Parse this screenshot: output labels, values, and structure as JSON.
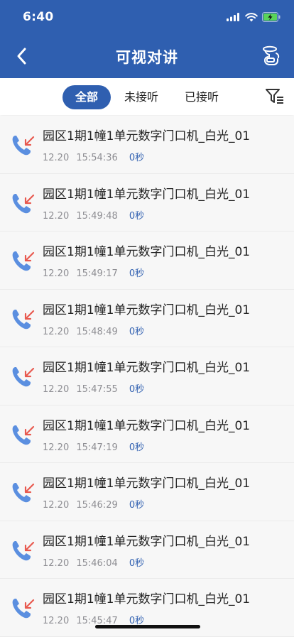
{
  "status_bar": {
    "time": "6:40"
  },
  "navbar": {
    "title": "可视对讲",
    "back_icon": "chevron-left-icon",
    "right_icon": "intercom-handset-icon"
  },
  "tabs": [
    {
      "label": "全部",
      "active": true
    },
    {
      "label": "未接听",
      "active": false
    },
    {
      "label": "已接听",
      "active": false
    }
  ],
  "filter_icon": "filter-icon",
  "colors": {
    "brand": "#2f5fb0",
    "incoming_arrow": "#e85a4f",
    "phone_blue": "#5b8fe0"
  },
  "calls": [
    {
      "name": "园区1期1幢1单元数字门口机_白光_01",
      "date": "12.20",
      "time": "15:54:36",
      "duration": "0秒"
    },
    {
      "name": "园区1期1幢1单元数字门口机_白光_01",
      "date": "12.20",
      "time": "15:49:48",
      "duration": "0秒"
    },
    {
      "name": "园区1期1幢1单元数字门口机_白光_01",
      "date": "12.20",
      "time": "15:49:17",
      "duration": "0秒"
    },
    {
      "name": "园区1期1幢1单元数字门口机_白光_01",
      "date": "12.20",
      "time": "15:48:49",
      "duration": "0秒"
    },
    {
      "name": "园区1期1幢1单元数字门口机_白光_01",
      "date": "12.20",
      "time": "15:47:55",
      "duration": "0秒"
    },
    {
      "name": "园区1期1幢1单元数字门口机_白光_01",
      "date": "12.20",
      "time": "15:47:19",
      "duration": "0秒"
    },
    {
      "name": "园区1期1幢1单元数字门口机_白光_01",
      "date": "12.20",
      "time": "15:46:29",
      "duration": "0秒"
    },
    {
      "name": "园区1期1幢1单元数字门口机_白光_01",
      "date": "12.20",
      "time": "15:46:04",
      "duration": "0秒"
    },
    {
      "name": "园区1期1幢1单元数字门口机_白光_01",
      "date": "12.20",
      "time": "15:45:47",
      "duration": "0秒"
    }
  ]
}
